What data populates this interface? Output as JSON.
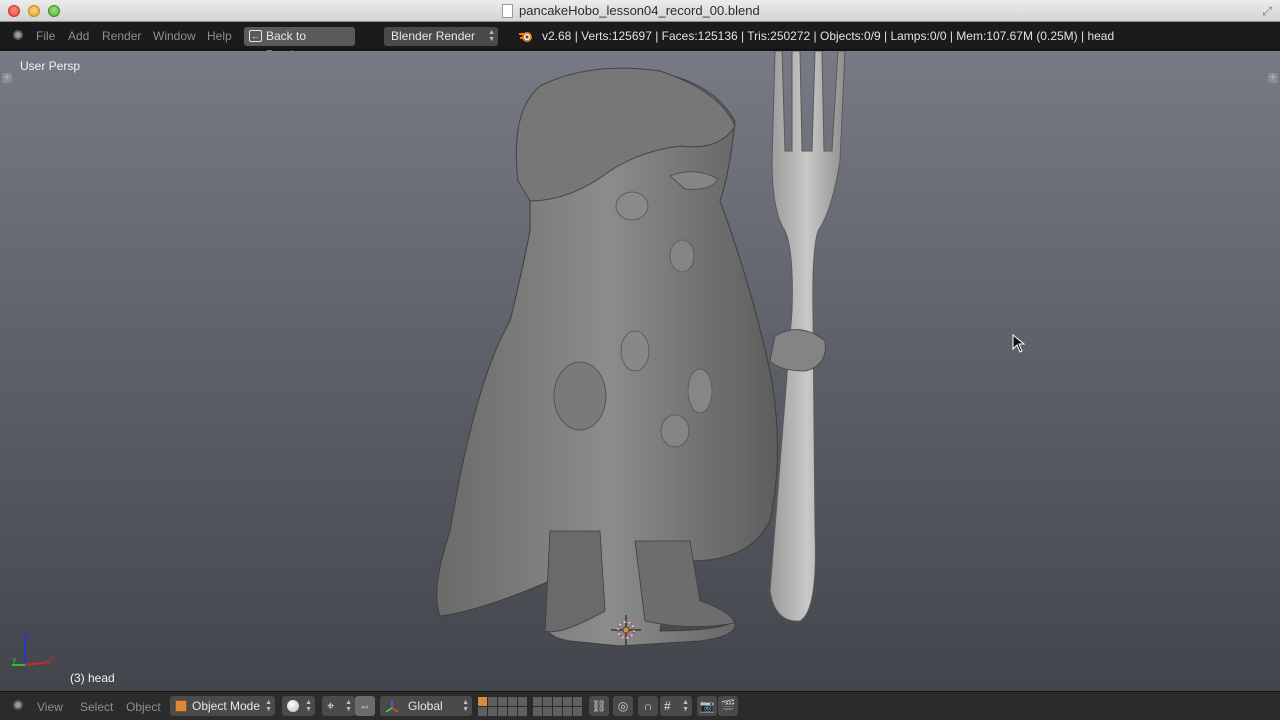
{
  "window": {
    "title": "pancakeHobo_lesson04_record_00.blend"
  },
  "info_header": {
    "menus": [
      "File",
      "Add",
      "Render",
      "Window",
      "Help"
    ],
    "back_button": "Back to Previous",
    "render_engine": "Blender Render",
    "stats": "v2.68 | Verts:125697 | Faces:125136 | Tris:250272 | Objects:0/9 | Lamps:0/0 | Mem:107.67M (0.25M) | head"
  },
  "viewport": {
    "view_label": "User Persp",
    "object_label": "(3) head",
    "axis_labels": {
      "x": "x",
      "y": "y",
      "z": "z"
    }
  },
  "view3d_header": {
    "menus": [
      "View",
      "Select",
      "Object"
    ],
    "mode": "Object Mode",
    "orientation": "Global"
  },
  "icons": {
    "back": "back-icon",
    "blender_logo": "blender-logo-icon",
    "fullscreen": "fullscreen-icon",
    "mode_cube": "cube-icon",
    "viewport_shading": "sphere-icon",
    "pivot": "pivot-icon",
    "manipulator": "manipulator-icon",
    "lock_layers": "lock-icon",
    "proportional": "proportional-edit-icon",
    "snap": "magnet-icon",
    "snap_element": "snap-grid-icon",
    "render_camera": "camera-icon",
    "render_anim": "clapperboard-icon"
  },
  "colors": {
    "accent_orange": "#e38b2b",
    "viewport_top": "#777a84",
    "viewport_bottom": "#43454c"
  }
}
